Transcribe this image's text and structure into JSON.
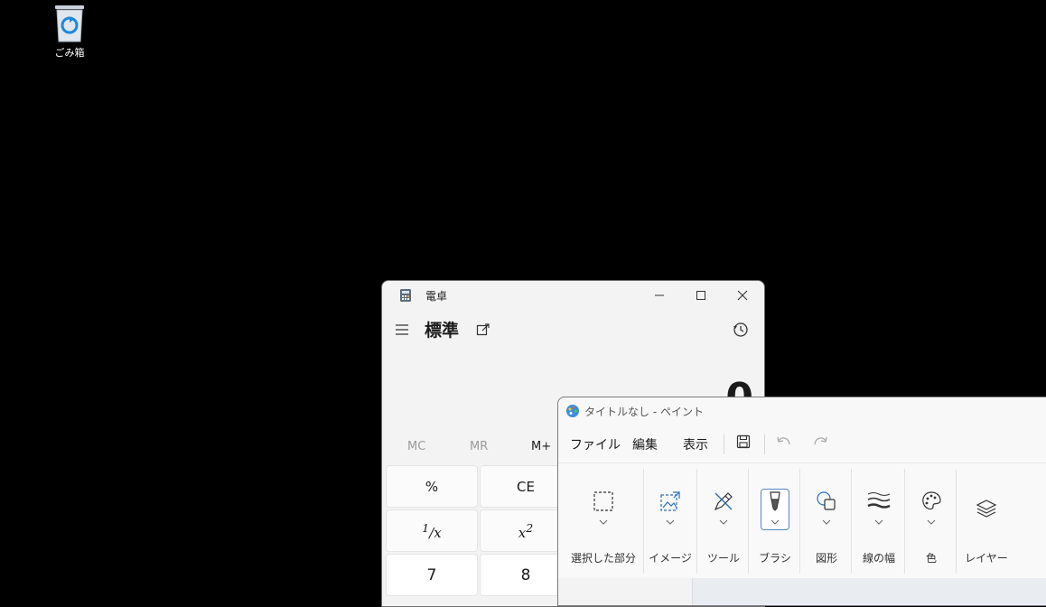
{
  "desktop": {
    "recycle_bin_label": "ごみ箱",
    "recycle_bin_icon": "recycle-bin-icon"
  },
  "calculator": {
    "title": "電卓",
    "mode": "標準",
    "display": "0",
    "memory": [
      "MC",
      "MR",
      "M+"
    ],
    "keys": {
      "percent": "%",
      "ce": "CE",
      "reciprocal_num": "1",
      "reciprocal_den": "x",
      "square_base": "x",
      "square_exp": "2",
      "seven": "7",
      "eight": "8"
    }
  },
  "paint": {
    "title": "タイトルなし - ペイント",
    "menu": [
      "ファイル",
      "編集",
      "表示"
    ],
    "groups": [
      "選択した部分",
      "イメージ",
      "ツール",
      "ブラシ",
      "図形",
      "線の幅",
      "色",
      "レイヤー"
    ]
  },
  "colors": {
    "accent": "#0067c0",
    "window_bg": "#f3f3f3",
    "desktop_bg": "#000000"
  }
}
